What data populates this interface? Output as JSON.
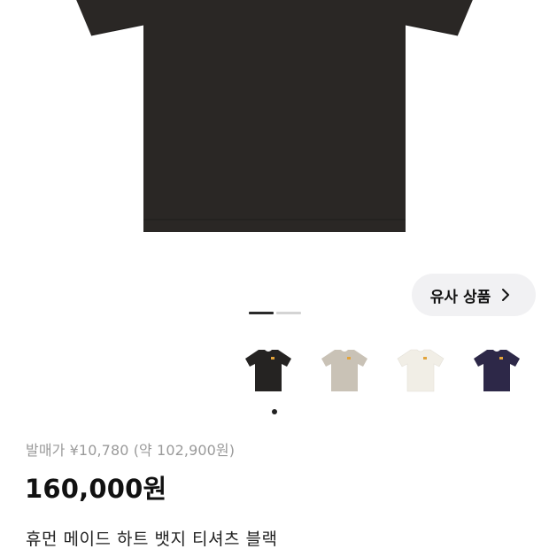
{
  "product_image": {
    "icon": "black-tshirt-image",
    "color": "#2a2725"
  },
  "similar_products": {
    "label": "유사 상품",
    "icon": "chevron-right-icon"
  },
  "pager": {
    "current": 1,
    "total": 2
  },
  "color_options": [
    {
      "name": "black",
      "color": "#252322",
      "selected": true
    },
    {
      "name": "beige",
      "color": "#c9c2b6",
      "selected": false
    },
    {
      "name": "white",
      "color": "#f1eee6",
      "selected": false
    },
    {
      "name": "navy",
      "color": "#2d2848",
      "selected": false
    }
  ],
  "badge_color": "#e2a33a",
  "release_price": "발매가 ¥10,780 (약 102,900원)",
  "price": "160,000원",
  "product_title": "휴먼 메이드 하트 뱃지 티셔츠 블랙"
}
